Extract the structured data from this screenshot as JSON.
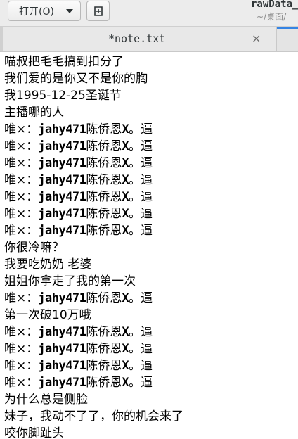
{
  "header": {
    "open_label": "打开(O)",
    "title": "rawData_",
    "subtitle": "~/桌面/"
  },
  "tab": {
    "label": "*note.txt",
    "close": "×"
  },
  "editor": {
    "lines": [
      {
        "text": "喵叔把毛毛搞到扣分了"
      },
      {
        "text": "我们爱的是你又不是你的胸"
      },
      {
        "text": "我1995-12-25圣诞节"
      },
      {
        "text": "主播哪的人"
      },
      {
        "a": "唯×：",
        "b": "jahy471",
        "c": "陈侨恩",
        "d": "X",
        "e": "。逼"
      },
      {
        "a": "唯×：",
        "b": "jahy471",
        "c": "陈侨恩",
        "d": "X",
        "e": "。逼"
      },
      {
        "a": "唯×：",
        "b": "jahy471",
        "c": "陈侨恩",
        "d": "X",
        "e": "。逼"
      },
      {
        "a": "唯×：",
        "b": "jahy471",
        "c": "陈侨恩",
        "d": "X",
        "e": "。逼"
      },
      {
        "a": "唯×：",
        "b": "jahy471",
        "c": "陈侨恩",
        "d": "X",
        "e": "。逼"
      },
      {
        "a": "唯×：",
        "b": "jahy471",
        "c": "陈侨恩",
        "d": "X",
        "e": "。逼"
      },
      {
        "a": "唯×：",
        "b": "jahy471",
        "c": "陈侨恩",
        "d": "X",
        "e": "。逼"
      },
      {
        "text": "你很冷嘛？"
      },
      {
        "text": "我要吃奶奶 老婆"
      },
      {
        "text": "姐姐你拿走了我的第一次"
      },
      {
        "a": "唯×：",
        "b": "jahy471",
        "c": "陈侨恩",
        "d": "X",
        "e": "。逼"
      },
      {
        "text": "第一次破10万哦"
      },
      {
        "a": "唯×：",
        "b": "jahy471",
        "c": "陈侨恩",
        "d": "X",
        "e": "。逼"
      },
      {
        "a": "唯×：",
        "b": "jahy471",
        "c": "陈侨恩",
        "d": "X",
        "e": "。逼"
      },
      {
        "a": "唯×：",
        "b": "jahy471",
        "c": "陈侨恩",
        "d": "X",
        "e": "。逼"
      },
      {
        "a": "唯×：",
        "b": "jahy471",
        "c": "陈侨恩",
        "d": "X",
        "e": "。逼"
      },
      {
        "text": "为什么总是侧脸"
      },
      {
        "text": "妹子，我动不了了，你的机会来了"
      },
      {
        "text": "咬你脚趾头"
      }
    ]
  }
}
